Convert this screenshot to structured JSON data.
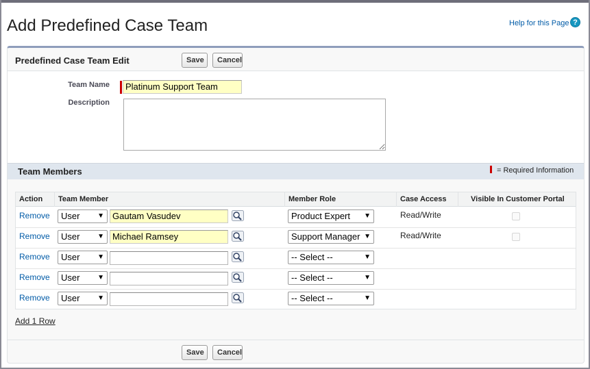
{
  "page": {
    "title": "Add Predefined Case Team",
    "help_link": "Help for this Page",
    "help_icon": "?"
  },
  "edit_panel": {
    "title": "Predefined Case Team Edit",
    "save_label": "Save",
    "cancel_label": "Cancel"
  },
  "form": {
    "team_name_label": "Team Name",
    "team_name_value": "Platinum Support Team",
    "description_label": "Description",
    "description_value": ""
  },
  "team_members": {
    "section_title": "Team Members",
    "required_info": "= Required Information",
    "columns": [
      "Action",
      "Team Member",
      "Member Role",
      "Case Access",
      "Visible In Customer Portal"
    ],
    "rows": [
      {
        "action": "Remove",
        "type": "User",
        "member": "Gautam Vasudev",
        "role": "Product Expert",
        "access": "Read/Write",
        "visible": false
      },
      {
        "action": "Remove",
        "type": "User",
        "member": "Michael Ramsey",
        "role": "Support Manager",
        "access": "Read/Write",
        "visible": false
      },
      {
        "action": "Remove",
        "type": "User",
        "member": "",
        "role": "-- Select --",
        "access": "",
        "visible": false
      },
      {
        "action": "Remove",
        "type": "User",
        "member": "",
        "role": "-- Select --",
        "access": "",
        "visible": false
      },
      {
        "action": "Remove",
        "type": "User",
        "member": "",
        "role": "-- Select --",
        "access": "",
        "visible": false
      }
    ],
    "add_row_label": "Add 1 Row"
  },
  "footer": {
    "save_label": "Save",
    "cancel_label": "Cancel"
  },
  "colors": {
    "link": "#015ba7",
    "required": "#cc0000",
    "highlight_input": "#ffffc4",
    "section_bar": "#dfe6ee"
  },
  "icons": {
    "help": "question-circle-icon",
    "lookup": "magnifier-icon",
    "dropdown": "triangle-down-icon"
  }
}
